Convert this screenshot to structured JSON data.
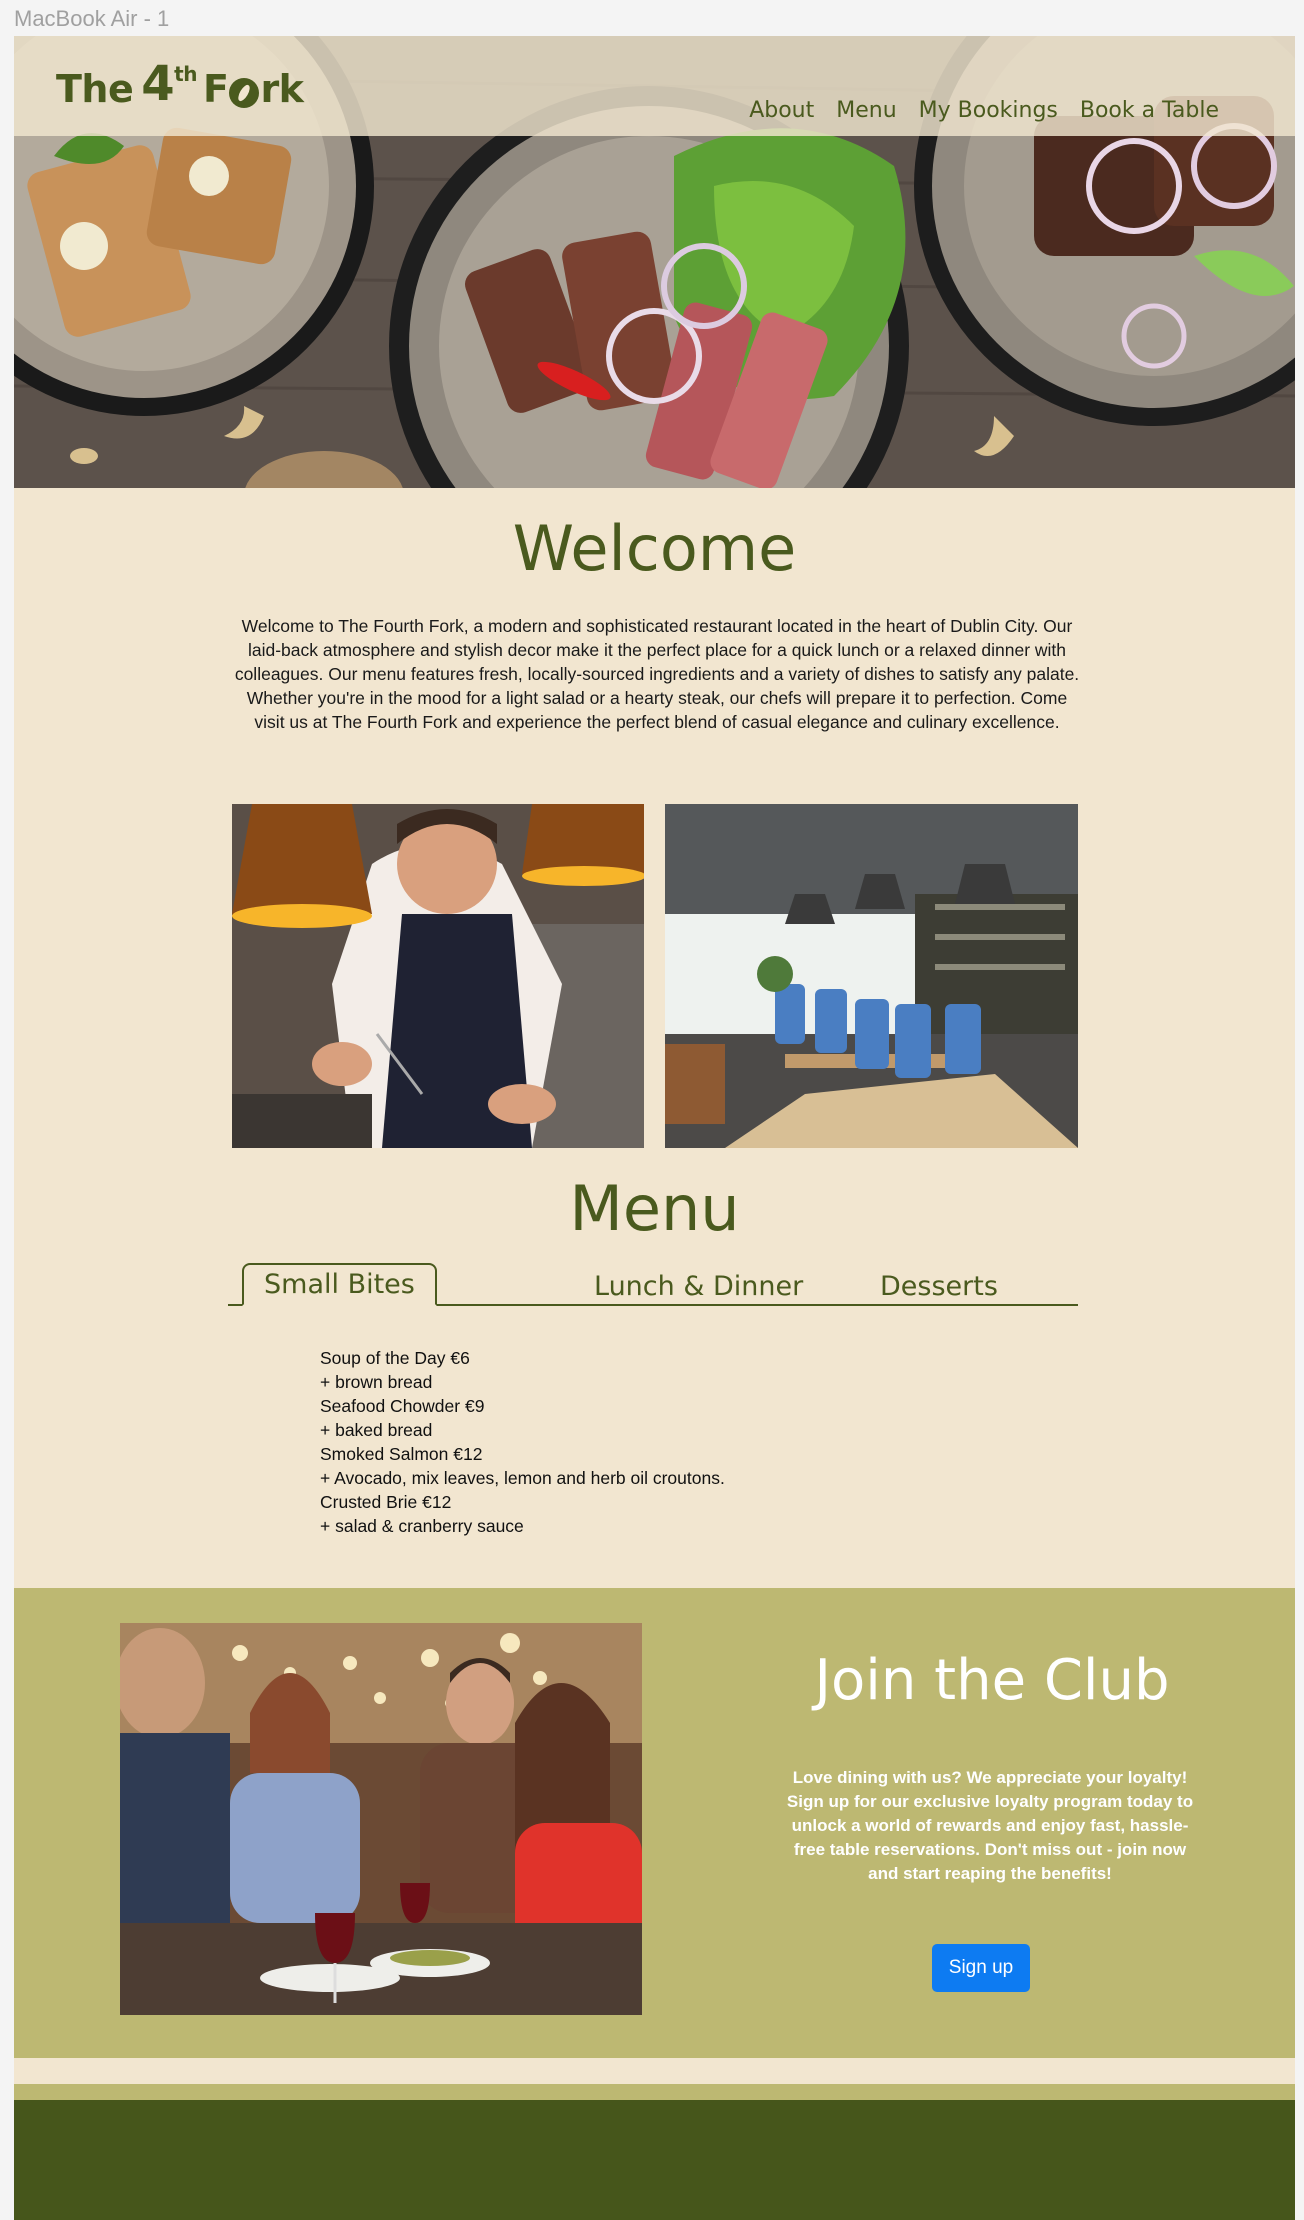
{
  "frame": {
    "label": "MacBook Air - 1"
  },
  "brand": {
    "prefix": "The",
    "number": "4",
    "superscript": "th",
    "suffix_start": "F",
    "suffix_end": "rk"
  },
  "nav": {
    "items": [
      "About",
      "Menu",
      "My Bookings",
      "Book a Table"
    ]
  },
  "welcome": {
    "title": "Welcome",
    "text": "Welcome to The Fourth Fork, a modern and sophisticated restaurant located in the heart of Dublin City. Our laid-back atmosphere and stylish decor make it the perfect place for a quick lunch or a relaxed dinner with colleagues. Our menu features fresh, locally-sourced ingredients and a variety of dishes to satisfy any palate. Whether you're in the mood for a light salad or a hearty steak, our chefs will prepare it to perfection. Come visit us at The Fourth Fork and experience the perfect blend of casual elegance and culinary excellence."
  },
  "menu": {
    "title": "Menu",
    "tabs": [
      "Small Bites",
      "Lunch & Dinner",
      "Desserts"
    ],
    "active_tab": "Small Bites",
    "items": [
      "Soup of the Day  €6",
      "+ brown bread",
      "Seafood Chowder  €9",
      "+ baked bread",
      "Smoked Salmon €12",
      "+ Avocado, mix leaves, lemon and herb oil croutons.",
      "Crusted Brie €12",
      "+ salad & cranberry sauce"
    ]
  },
  "club": {
    "title": "Join the Club",
    "text": "Love dining with us? We appreciate your loyalty! Sign up for our exclusive loyalty program today to unlock a world of rewards and enjoy fast, hassle-free table reservations. Don't miss out - join now and start reaping the benefits!",
    "button": "Sign up"
  },
  "colors": {
    "brand_green": "#4a5a1e",
    "background_cream": "#f2e6d0",
    "club_olive": "#bdb872",
    "footer_green": "#46561b",
    "button_blue": "#0d7bf2"
  }
}
